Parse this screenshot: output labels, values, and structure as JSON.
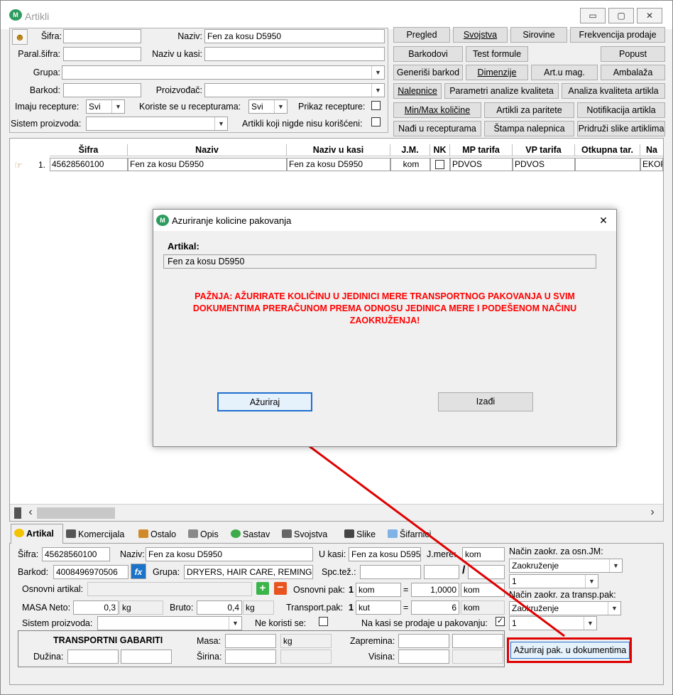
{
  "window": {
    "title": "Artikli",
    "min": "▭",
    "max": "▢",
    "close": "✕"
  },
  "filters": {
    "sifra_label": "Šifra:",
    "sifra_value": "",
    "naziv_label": "Naziv:",
    "naziv_value": "Fen za kosu D5950",
    "paral_label": "Paral.šifra:",
    "paral_value": "",
    "naziv_kasi_label": "Naziv u kasi:",
    "naziv_kasi_value": "",
    "grupa_label": "Grupa:",
    "grupa_value": "",
    "barkod_label": "Barkod:",
    "barkod_value": "",
    "proizvodjac_label": "Proizvođač:",
    "proizvodjac_value": "",
    "imaju_label": "Imaju recepture:",
    "imaju_value": "Svi",
    "koriste_label": "Koriste se u recepturama:",
    "koriste_value": "Svi",
    "prikaz_label": "Prikaz recepture:",
    "sistem_label": "Sistem proizvoda:",
    "sistem_value": "",
    "nikad_label": "Artikli koji nigde nisu korišćeni:"
  },
  "toolbar": {
    "pregled": "Pregled",
    "svojstva": "Svojstva",
    "sirovine": "Sirovine",
    "frekvencija": "Frekvencija prodaje",
    "barkodovi": "Barkodovi",
    "test_formule": "Test formule",
    "popust": "Popust",
    "generisi_barkod": "Generiši barkod",
    "dimenzije": "Dimenzije",
    "art_mag": "Art.u mag.",
    "ambalaza": "Ambalaža",
    "nalepnice": "Nalepnice",
    "parametri": "Parametri analize kvaliteta",
    "analiza": "Analiza kvaliteta artikla",
    "minmax": "Min/Max količine",
    "paritete": "Artikli za paritete",
    "notifikacija": "Notifikacija artikla",
    "nadji": "Nađi u recepturama",
    "stampa": "Štampa nalepnica",
    "pridruzi": "Pridruži slike artiklima"
  },
  "grid": {
    "columns": [
      "Šifra",
      "Naziv",
      "Naziv u kasi",
      "J.M.",
      "NK",
      "MP tarifa",
      "VP tarifa",
      "Otkupna tar.",
      "Na"
    ],
    "rows": [
      {
        "num": "1.",
        "sifra": "45628560100",
        "naziv": "Fen za kosu D5950",
        "naziv_kasi": "Fen za kosu D5950",
        "jm": "kom",
        "nk": "",
        "mp": "PDVOS",
        "vp": "PDVOS",
        "otkupna": "",
        "na": "EKOP"
      }
    ],
    "scroll_left": "‹",
    "scroll_right": "›"
  },
  "dialog": {
    "title": "Azuriranje kolicine pakovanja",
    "close": "✕",
    "artikal_label": "Artikal:",
    "artikal_value": "Fen za kosu D5950",
    "warning": "PAŽNJA: AŽURIRATE KOLIČINU U JEDINICI MERE TRANSPORTNOG PAKOVANJA U SVIM DOKUMENTIMA PRERAČUNOM PREMA ODNOSU JEDINICA MERE I PODEŠENOM NAČINU ZAOKRUŽENJA!",
    "azuriraj": "Ažuriraj",
    "izadji": "Izađi"
  },
  "tabs": [
    "Artikal",
    "Komercijala",
    "Ostalo",
    "Opis",
    "Sastav",
    "Svojstva",
    "Slike",
    "Šifarnici"
  ],
  "detail": {
    "sifra_label": "Šifra:",
    "sifra": "45628560100",
    "naziv_label": "Naziv:",
    "naziv": "Fen za kosu D5950",
    "ukasi_label": "U kasi:",
    "ukasi": "Fen za kosu D595",
    "jmere_label": "J.mere:",
    "jmere": "kom",
    "barkod_label": "Barkod:",
    "barkod": "4008496970506",
    "grupa_label": "Grupa:",
    "grupa": "DRYERS, HAIR CARE, REMINGTON",
    "spcte_label": "Spc.tež.:",
    "slash": "/",
    "osnovni_label": "Osnovni artikal:",
    "osnovni_pak_label": "Osnovni pak:",
    "osnovni_pak_num": "1",
    "osnovni_pak_jm": "kom",
    "eq": "=",
    "osnovni_qty": "1,0000",
    "osnovni_unit": "kom",
    "masa_neto_label": "MASA Neto:",
    "masa_neto": "0,3",
    "masa_neto_unit": "kg",
    "bruto_label": "Bruto:",
    "bruto": "0,4",
    "bruto_unit": "kg",
    "transport_label": "Transport.pak:",
    "transport_num": "1",
    "transport_jm": "kut",
    "transport_qty": "6",
    "transport_unit": "kom",
    "sistem_label": "Sistem proizvoda:",
    "sistem": "",
    "ne_koristi_label": "Ne koristi se:",
    "na_kasi_label": "Na kasi se prodaje u pakovanju:",
    "nacin_osn_label": "Način zaokr. za osn.JM:",
    "nacin_osn": "Zaokruženje",
    "nacin_osn_num": "1",
    "nacin_tr_label": "Način zaokr. za transp.pak:",
    "nacin_tr": "Zaokruženje",
    "nacin_tr_num": "1",
    "gabariti_title": "TRANSPORTNI GABARITI",
    "duzina_label": "Dužina:",
    "sirina_label": "Širina:",
    "masa_label": "Masa:",
    "masa_unit": "kg",
    "zapremina_label": "Zapremina:",
    "visina_label": "Visina:",
    "azuriraj_pak": "Ažuriraj pak. u dokumentima"
  },
  "colors": {
    "annotation": "#e00000",
    "warning": "#ff0000",
    "focus": "#1f6fd0"
  }
}
